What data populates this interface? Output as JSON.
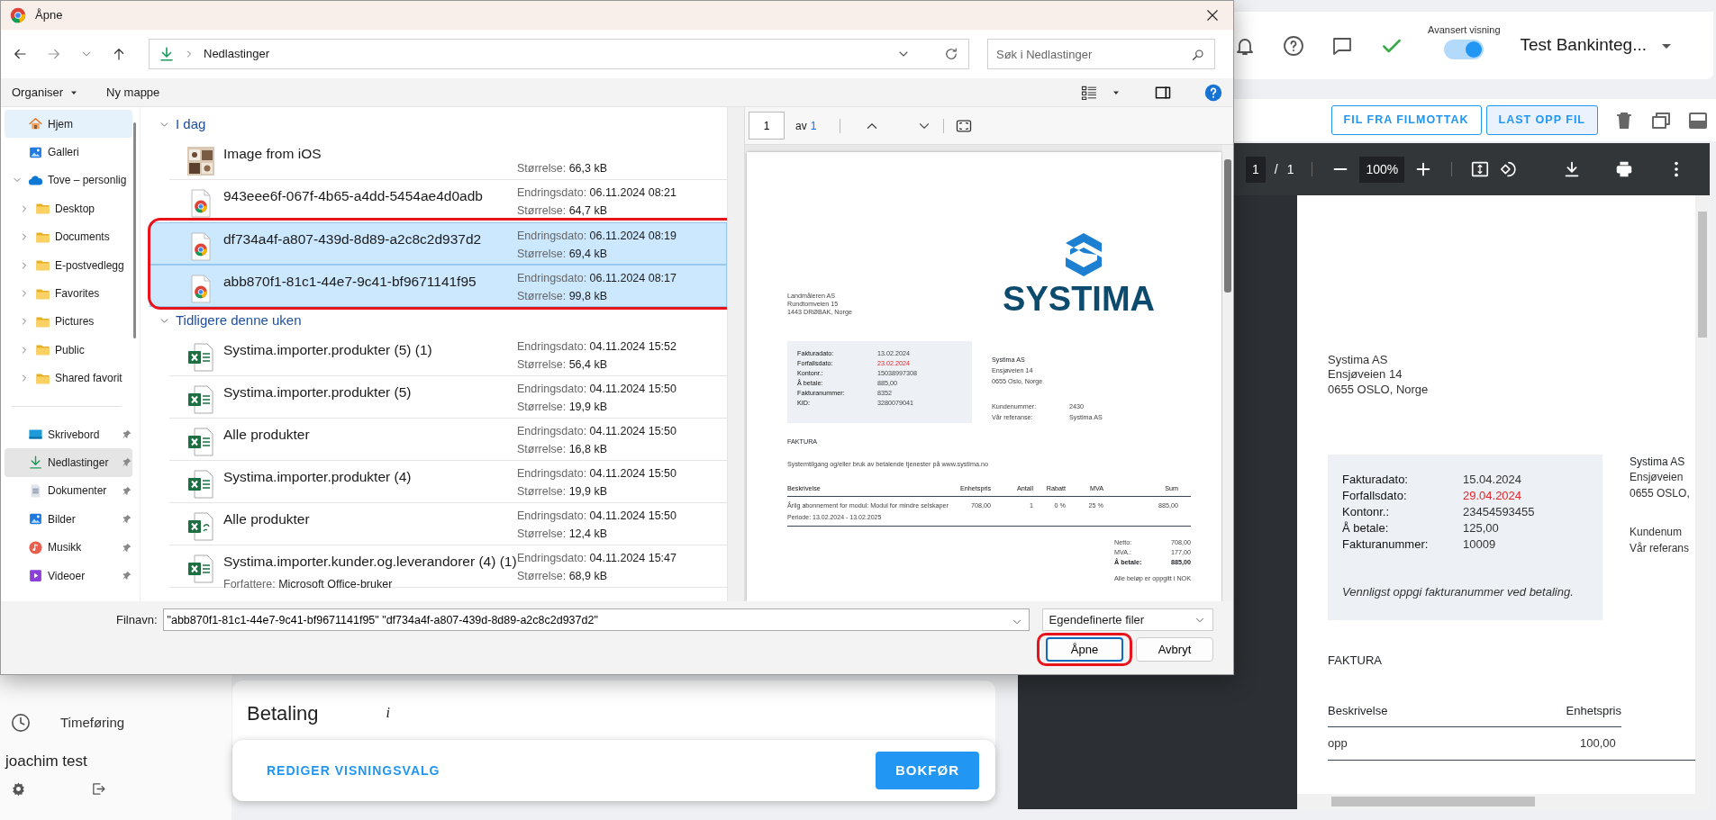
{
  "dialog": {
    "title": "Åpne",
    "path": "Nedlastinger",
    "search_placeholder": "Søk i Nedlastinger",
    "toolbar": [
      {
        "label": "Organiser",
        "kind": "menu"
      },
      {
        "label": "Ny mappe",
        "kind": "plain"
      }
    ],
    "tree": [
      {
        "label": "Hjem",
        "kind": "home",
        "selected": false,
        "hovered": true
      },
      {
        "label": "Galleri",
        "kind": "gallery",
        "selected": false,
        "hovered": false
      },
      {
        "label": "Tove – personlig",
        "kind": "cloud",
        "selected": false,
        "hovered": false,
        "expanded": true,
        "children": [
          {
            "label": "Desktop",
            "kind": "folder",
            "selected": false,
            "hovered": false,
            "expanded": false
          },
          {
            "label": "Documents",
            "kind": "folder",
            "selected": false,
            "hovered": false,
            "expanded": false
          },
          {
            "label": "E-postvedlegg",
            "kind": "folder",
            "selected": false,
            "hovered": false,
            "expanded": false
          },
          {
            "label": "Favorites",
            "kind": "folder",
            "selected": false,
            "hovered": false,
            "expanded": false
          },
          {
            "label": "Pictures",
            "kind": "folder",
            "selected": false,
            "hovered": false,
            "expanded": false
          },
          {
            "label": "Public",
            "kind": "folder",
            "selected": false,
            "hovered": false,
            "expanded": false
          },
          {
            "label": "Shared favorit",
            "kind": "folder",
            "selected": false,
            "hovered": false,
            "expanded": false
          }
        ]
      }
    ],
    "quick_access": [
      {
        "label": "Skrivebord",
        "kind": "desktop",
        "selected": false,
        "hovered": false,
        "pinned": true
      },
      {
        "label": "Nedlastinger",
        "kind": "download",
        "selected": true,
        "hovered": false,
        "pinned": true
      },
      {
        "label": "Dokumenter",
        "kind": "document",
        "selected": false,
        "hovered": false,
        "pinned": true
      },
      {
        "label": "Bilder",
        "kind": "gallery",
        "selected": false,
        "hovered": false,
        "pinned": true
      },
      {
        "label": "Musikk",
        "kind": "music",
        "selected": false,
        "hovered": false,
        "pinned": true
      },
      {
        "label": "Videoer",
        "kind": "video",
        "selected": false,
        "hovered": false,
        "pinned": true
      }
    ],
    "groups": [
      {
        "label": "I dag",
        "expanded": true,
        "files": [
          {
            "name": "Image from iOS",
            "selected": false,
            "circled": false,
            "details": [
              {
                "label": "Størrelse:",
                "value": "66,3 kB"
              }
            ]
          },
          {
            "name": "943eee6f-067f-4b65-a4dd-5454ae4d0adb",
            "kind": "browser",
            "selected": false,
            "circled": false,
            "details": [
              {
                "label": "Endringsdato:",
                "value": "06.11.2024 08:21"
              },
              {
                "label": "Størrelse:",
                "value": "64,7 kB"
              }
            ]
          },
          {
            "name": "df734a4f-a807-439d-8d89-a2c8c2d937d2",
            "kind": "browser",
            "selected": true,
            "circled": true,
            "details": [
              {
                "label": "Endringsdato:",
                "value": "06.11.2024 08:19"
              },
              {
                "label": "Størrelse:",
                "value": "69,4 kB"
              }
            ]
          },
          {
            "name": "abb870f1-81c1-44e7-9c41-bf9671141f95",
            "kind": "browser",
            "selected": true,
            "circled": true,
            "details": [
              {
                "label": "Endringsdato:",
                "value": "06.11.2024 08:17"
              },
              {
                "label": "Størrelse:",
                "value": "99,8 kB"
              }
            ]
          }
        ]
      },
      {
        "label": "Tidligere denne uken",
        "expanded": true,
        "files": [
          {
            "name": "Systima.importer.produkter (5) (1)",
            "kind": "excel",
            "selected": false,
            "circled": false,
            "details": [
              {
                "label": "Endringsdato:",
                "value": "04.11.2024 15:52"
              },
              {
                "label": "Størrelse:",
                "value": "56,4 kB"
              }
            ]
          },
          {
            "name": "Systima.importer.produkter (5)",
            "kind": "excel",
            "selected": false,
            "circled": false,
            "details": [
              {
                "label": "Endringsdato:",
                "value": "04.11.2024 15:50"
              },
              {
                "label": "Størrelse:",
                "value": "19,9 kB"
              }
            ]
          },
          {
            "name": "Alle produkter",
            "kind": "excel",
            "selected": false,
            "circled": false,
            "details": [
              {
                "label": "Endringsdato:",
                "value": "04.11.2024 15:50"
              },
              {
                "label": "Størrelse:",
                "value": "16,8 kB"
              }
            ]
          },
          {
            "name": "Systima.importer.produkter (4)",
            "kind": "excel",
            "selected": false,
            "circled": false,
            "details": [
              {
                "label": "Endringsdato:",
                "value": "04.11.2024 15:50"
              },
              {
                "label": "Størrelse:",
                "value": "19,9 kB"
              }
            ]
          },
          {
            "name": "Alle produkter",
            "kind": "csv",
            "selected": false,
            "circled": false,
            "details": [
              {
                "label": "Endringsdato:",
                "value": "04.11.2024 15:50"
              },
              {
                "label": "Størrelse:",
                "value": "12,4 kB"
              }
            ]
          },
          {
            "name": "Systima.importer.kunder.og.leverandorer (4) (1)",
            "kind": "excel",
            "selected": false,
            "circled": false,
            "author": {
              "label": "Forfattere:",
              "value": "Microsoft Office-bruker"
            },
            "details": [
              {
                "label": "Endringsdato:",
                "value": "04.11.2024 15:47"
              },
              {
                "label": "Størrelse:",
                "value": "68,9 kB"
              }
            ]
          }
        ]
      }
    ],
    "preview": {
      "page": "1",
      "of": "av",
      "total": "1",
      "invoice": {
        "sender": [
          "Landmåleren AS",
          "Rundtomveien 15",
          "1443 DRØBAK, Norge"
        ],
        "logo": "SYSTIMA",
        "info": [
          {
            "label": "Fakturadato:",
            "value": "13.02.2024",
            "warning": false
          },
          {
            "label": "Forfallsdato:",
            "value": "23.02.2024",
            "warning": true
          },
          {
            "label": "Kontonr.:",
            "value": "15038997308",
            "warning": false
          },
          {
            "label": "Å betale:",
            "value": "885,00",
            "warning": false
          },
          {
            "label": "Fakturanummer:",
            "value": "8352",
            "warning": false
          },
          {
            "label": "KID:",
            "value": "3280079041",
            "warning": false
          }
        ],
        "recipient": [
          "Systima AS",
          "Ensjøveien 14",
          "0655 Oslo, Norge"
        ],
        "refs": [
          {
            "label": "Kundenummer:",
            "value": "2430"
          },
          {
            "label": "Vår referanse:",
            "value": "Systima AS"
          }
        ],
        "heading": "FAKTURA",
        "description": "Systemtilgang og/eller bruk av betalende tjenester på www.systima.no",
        "columns": [
          "Beskrivelse",
          "Enhetspris",
          "Antall",
          "Rabatt",
          "MVA",
          "Sum"
        ],
        "lines": [
          {
            "cells": [
              "Årlig abonnement for modul: Modul for mindre selskaper",
              "708,00",
              "1",
              "0 %",
              "25 %",
              "885,00"
            ],
            "note": "Periode: 13.02.2024 - 13.02.2025"
          }
        ],
        "totals": [
          {
            "label": "Netto:",
            "value": "708,00",
            "bold": false
          },
          {
            "label": "MVA.:",
            "value": "177,00",
            "bold": false
          },
          {
            "label": "Å betale:",
            "value": "885,00",
            "bold": true
          }
        ],
        "footnote": "Alle beløp er oppgitt i NOK"
      }
    },
    "filename": {
      "label": "Filnavn:",
      "value": "\"abb870f1-81c1-44e7-9c41-bf9671141f95\" \"df734a4f-a807-439d-8d89-a2c8c2d937d2\"",
      "type": "Egendefinerte filer"
    },
    "buttons": [
      {
        "label": "Åpne",
        "kind": "primary",
        "circled": true
      },
      {
        "label": "Avbryt",
        "kind": "secondary",
        "circled": false
      }
    ]
  },
  "app": {
    "header": {
      "toggle": {
        "label": "Avansert visning",
        "on": true
      },
      "company": "Test Bankinteg..."
    },
    "file_actions": [
      {
        "label": "FIL FRA FILMOTTAK",
        "active": false
      },
      {
        "label": "LAST OPP FIL",
        "active": true
      }
    ],
    "viewer": {
      "page": "1",
      "separator": "/",
      "total": "1",
      "zoom": "100%",
      "invoice": {
        "recipient": [
          "Systima AS",
          "Ensjøveien 14",
          "0655 OSLO, Norge"
        ],
        "info": [
          {
            "label": "Fakturadato:",
            "value": "15.04.2024",
            "warning": false
          },
          {
            "label": "Forfallsdato:",
            "value": "29.04.2024",
            "warning": true
          },
          {
            "label": "Kontonr.:",
            "value": "23454593455",
            "warning": false
          },
          {
            "label": "Å betale:",
            "value": "125,00",
            "warning": false
          },
          {
            "label": "Fakturanummer:",
            "value": "10009",
            "warning": false
          }
        ],
        "note": "Vennligst oppgi fakturanummer ved betaling.",
        "sender": [
          "Systima AS",
          "Ensjøveien",
          "0655 OSLO,"
        ],
        "refs": [
          "Kundenum",
          "Vår referans"
        ],
        "heading": "FAKTURA",
        "columns": [
          "Beskrivelse",
          "Enhetspris"
        ],
        "rows": [
          [
            "opp",
            "100,00"
          ]
        ]
      }
    },
    "main": {
      "section_title": "Betaling",
      "info": "i",
      "edit_label": "REDIGER VISNINGSVALG",
      "post_label": "BOKFØR"
    },
    "sidebar": {
      "items": [
        {
          "label": "Timeføring",
          "kind": "clock"
        }
      ],
      "user": "joachim test"
    }
  }
}
